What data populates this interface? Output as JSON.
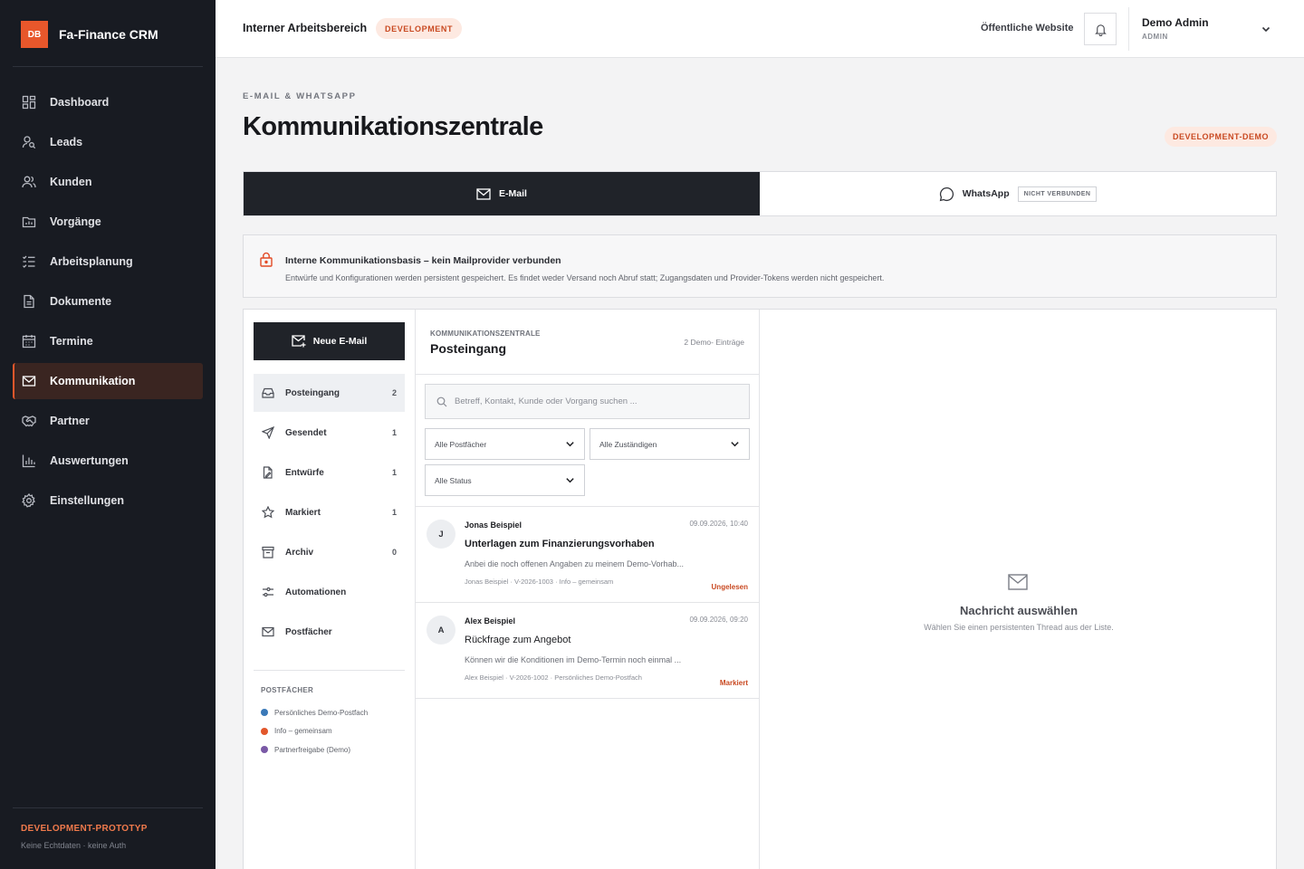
{
  "app": {
    "logo": "DB",
    "name": "Fa-Finance CRM"
  },
  "sidebar": {
    "items": [
      {
        "label": "Dashboard",
        "icon": "dashboard-icon"
      },
      {
        "label": "Leads",
        "icon": "user-search-icon"
      },
      {
        "label": "Kunden",
        "icon": "users-icon"
      },
      {
        "label": "Vorgänge",
        "icon": "folder-chart-icon"
      },
      {
        "label": "Arbeitsplanung",
        "icon": "checklist-icon"
      },
      {
        "label": "Dokumente",
        "icon": "document-icon"
      },
      {
        "label": "Termine",
        "icon": "calendar-icon"
      },
      {
        "label": "Kommunikation",
        "icon": "mail-icon",
        "active": true
      },
      {
        "label": "Partner",
        "icon": "handshake-icon"
      },
      {
        "label": "Auswertungen",
        "icon": "bar-chart-icon"
      },
      {
        "label": "Einstellungen",
        "icon": "gear-icon"
      }
    ],
    "footer": {
      "title": "DEVELOPMENT-PROTOTYP",
      "subtitle": "Keine Echtdaten · keine Auth"
    }
  },
  "header": {
    "workspace": "Interner Arbeitsbereich",
    "env_badge": "DEVELOPMENT",
    "public_link": "Öffentliche Website",
    "user": {
      "name": "Demo Admin",
      "role": "ADMIN"
    }
  },
  "page": {
    "eyebrow": "E-MAIL & WHATSAPP",
    "title": "Kommunikationszentrale",
    "badge": "DEVELOPMENT-DEMO"
  },
  "tabs": {
    "email": "E-Mail",
    "whatsapp": "WhatsApp",
    "whatsapp_status": "NICHT VERBUNDEN"
  },
  "notice": {
    "title": "Interne Kommunikationsbasis – kein Mailprovider verbunden",
    "text": "Entwürfe und Konfigurationen werden persistent gespeichert. Es findet weder Versand noch Abruf statt; Zugangsdaten und Provider-Tokens werden nicht gespeichert."
  },
  "folders": {
    "new_mail": "Neue E-Mail",
    "items": [
      {
        "label": "Posteingang",
        "count": "2",
        "active": true
      },
      {
        "label": "Gesendet",
        "count": "1"
      },
      {
        "label": "Entwürfe",
        "count": "1"
      },
      {
        "label": "Markiert",
        "count": "1"
      },
      {
        "label": "Archiv",
        "count": "0"
      },
      {
        "label": "Automationen",
        "count": ""
      },
      {
        "label": "Postfächer",
        "count": ""
      }
    ],
    "boxes_title": "POSTFÄCHER",
    "boxes": [
      {
        "label": "Persönliches Demo-Postfach",
        "color": "#3a79b8"
      },
      {
        "label": "Info – gemeinsam",
        "color": "#e2572b"
      },
      {
        "label": "Partnerfreigabe (Demo)",
        "color": "#7a59a6"
      }
    ]
  },
  "list": {
    "eyebrow": "KOMMUNIKATIONSZENTRALE",
    "title": "Posteingang",
    "count": "2 Demo- Einträge",
    "search_placeholder": "Betreff, Kontakt, Kunde oder Vorgang suchen ...",
    "filters": {
      "mailbox": "Alle Postfächer",
      "assignee": "Alle Zuständigen",
      "status": "Alle Status"
    },
    "threads": [
      {
        "initial": "J",
        "from": "Jonas Beispiel",
        "date": "09.09.2026, 10:40",
        "subject": "Unterlagen zum Finanzierungsvorhaben",
        "preview": "Anbei die noch offenen Angaben zu meinem Demo-Vorhab...",
        "meta": "Jonas Beispiel · V-2026-1003 · Info – gemeinsam",
        "status": "Ungelesen"
      },
      {
        "initial": "A",
        "from": "Alex Beispiel",
        "date": "09.09.2026, 09:20",
        "subject": "Rückfrage zum Angebot",
        "preview": "Können wir die Konditionen im Demo-Termin noch einmal ...",
        "meta": "Alex Beispiel · V-2026-1002 · Persönliches Demo-Postfach",
        "status": "Markiert"
      }
    ]
  },
  "detail": {
    "empty_title": "Nachricht auswählen",
    "empty_sub": "Wählen Sie einen persistenten Thread aus der Liste."
  },
  "colors": {
    "accent": "#e8572b",
    "sidebar_bg": "#181b22",
    "dark_button": "#202329"
  }
}
